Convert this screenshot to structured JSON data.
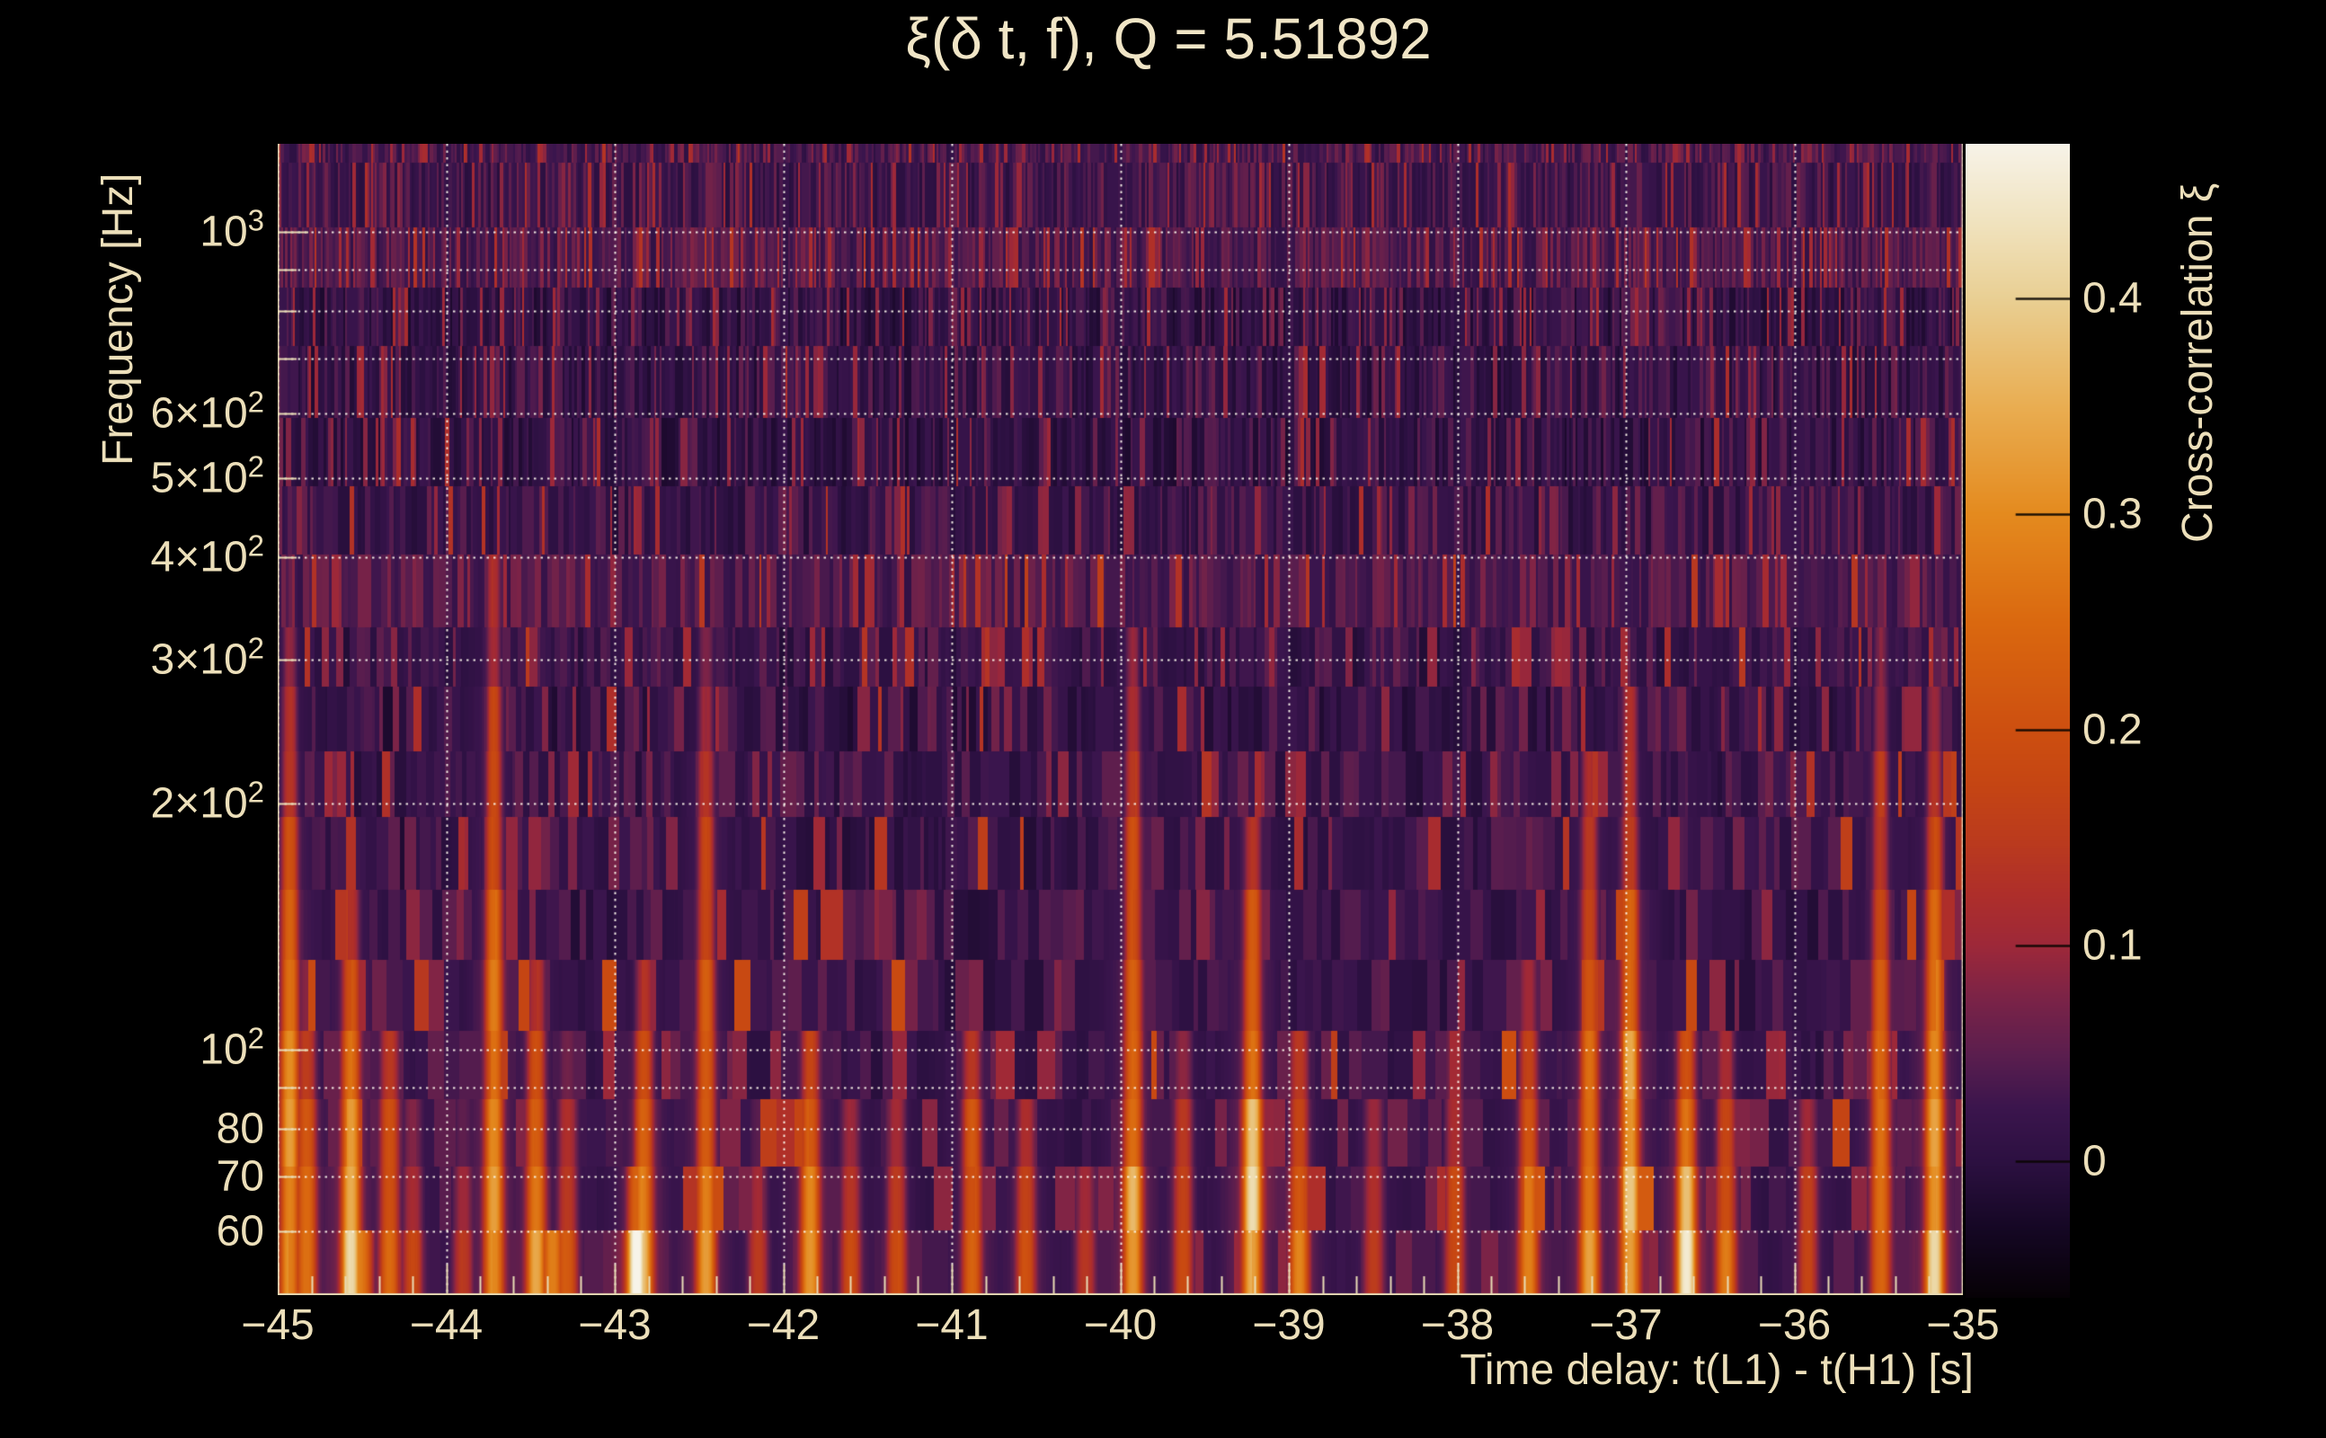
{
  "page": {
    "background": "#000000",
    "text_color": "#ecdfba",
    "title_color": "#f0e5c6"
  },
  "chart_data": {
    "type": "heatmap",
    "title": "ξ(δ t, f), Q = 5.51892",
    "q_value": 5.51892,
    "xlabel": "Time delay: t(L1) - t(H1) [s]",
    "ylabel": "Frequency [Hz]",
    "colorbar_label": "Cross-correlation ξ",
    "x_range_s": [
      -45,
      -35
    ],
    "x_major_tick_step_s": 1,
    "x_minor_tick_step_s": 0.2,
    "x_ticks": [
      {
        "t": -45,
        "label": "−45"
      },
      {
        "t": -44,
        "label": "−44"
      },
      {
        "t": -43,
        "label": "−43"
      },
      {
        "t": -42,
        "label": "−42"
      },
      {
        "t": -41,
        "label": "−41"
      },
      {
        "t": -40,
        "label": "−40"
      },
      {
        "t": -39,
        "label": "−39"
      },
      {
        "t": -38,
        "label": "−38"
      },
      {
        "t": -37,
        "label": "−37"
      },
      {
        "t": -36,
        "label": "−36"
      },
      {
        "t": -35,
        "label": "−35"
      }
    ],
    "y_scale": "log",
    "y_range_hz": [
      50,
      1282
    ],
    "y_ticks": [
      {
        "f": 1000,
        "base": "10",
        "sup": "3"
      },
      {
        "f": 600,
        "base": "6×10",
        "sup": "2"
      },
      {
        "f": 500,
        "base": "5×10",
        "sup": "2"
      },
      {
        "f": 400,
        "base": "4×10",
        "sup": "2"
      },
      {
        "f": 300,
        "base": "3×10",
        "sup": "2"
      },
      {
        "f": 200,
        "base": "2×10",
        "sup": "2"
      },
      {
        "f": 100,
        "base": "10",
        "sup": "2"
      },
      {
        "f": 80,
        "base": "80"
      },
      {
        "f": 70,
        "base": "70"
      },
      {
        "f": 60,
        "base": "60"
      }
    ],
    "y_gridline_freqs_hz": [
      60,
      70,
      80,
      90,
      100,
      200,
      300,
      400,
      500,
      600,
      700,
      800,
      900,
      1000
    ],
    "grid_style": "dotted-white",
    "colorbar": {
      "range_xi": [
        -0.0633,
        0.4717
      ],
      "ticks": [
        {
          "v": 0.4,
          "label": "0.4"
        },
        {
          "v": 0.3,
          "label": "0.3"
        },
        {
          "v": 0.2,
          "label": "0.2"
        },
        {
          "v": 0.1,
          "label": "0.1"
        },
        {
          "v": 0.0,
          "label": "0"
        }
      ]
    },
    "colormap_stops": [
      [
        0.0,
        "#060105"
      ],
      [
        0.06,
        "#150724"
      ],
      [
        0.118,
        "#2c1041"
      ],
      [
        0.165,
        "#3b154d"
      ],
      [
        0.211,
        "#5b1e4e"
      ],
      [
        0.26,
        "#7b2347"
      ],
      [
        0.305,
        "#9d2839"
      ],
      [
        0.35,
        "#ae2e2a"
      ],
      [
        0.398,
        "#bb3b1d"
      ],
      [
        0.445,
        "#c54513"
      ],
      [
        0.492,
        "#cd4f10"
      ],
      [
        0.585,
        "#da680f"
      ],
      [
        0.679,
        "#e48a1e"
      ],
      [
        0.772,
        "#e9ad51"
      ],
      [
        0.866,
        "#e9cf93"
      ],
      [
        0.93,
        "#f0e2bd"
      ],
      [
        1.0,
        "#f7f3e8"
      ]
    ],
    "noise_model": {
      "seed": 20240917,
      "background_xi_mean": 0.01,
      "background_xi_spread": 0.05,
      "description": "mostly-dark purple Q-transform noise tiles; tile width grows toward low frequency; sparse brighter red/orange tiles, densest below ~130 Hz"
    },
    "hot_streaks": [
      {
        "t_s": -44.93,
        "f_max_hz": 360,
        "peak_xi": 0.3
      },
      {
        "t_s": -44.83,
        "f_max_hz": 120,
        "peak_xi": 0.26
      },
      {
        "t_s": -44.57,
        "f_max_hz": 170,
        "peak_xi": 0.34
      },
      {
        "t_s": -44.5,
        "f_max_hz": 58,
        "peak_xi": 0.4
      },
      {
        "t_s": -44.34,
        "f_max_hz": 115,
        "peak_xi": 0.25
      },
      {
        "t_s": -44.2,
        "f_max_hz": 90,
        "peak_xi": 0.17
      },
      {
        "t_s": -43.9,
        "f_max_hz": 80,
        "peak_xi": 0.15
      },
      {
        "t_s": -43.72,
        "f_max_hz": 430,
        "peak_xi": 0.29
      },
      {
        "t_s": -43.47,
        "f_max_hz": 140,
        "peak_xi": 0.32
      },
      {
        "t_s": -43.37,
        "f_max_hz": 62,
        "peak_xi": 0.43
      },
      {
        "t_s": -43.28,
        "f_max_hz": 100,
        "peak_xi": 0.21
      },
      {
        "t_s": -42.87,
        "f_max_hz": 76,
        "peak_xi": 0.46
      },
      {
        "t_s": -42.83,
        "f_max_hz": 140,
        "peak_xi": 0.28
      },
      {
        "t_s": -42.46,
        "f_max_hz": 310,
        "peak_xi": 0.28
      },
      {
        "t_s": -42.15,
        "f_max_hz": 80,
        "peak_xi": 0.16
      },
      {
        "t_s": -41.84,
        "f_max_hz": 115,
        "peak_xi": 0.3
      },
      {
        "t_s": -41.6,
        "f_max_hz": 90,
        "peak_xi": 0.17
      },
      {
        "t_s": -41.33,
        "f_max_hz": 85,
        "peak_xi": 0.24
      },
      {
        "t_s": -40.88,
        "f_max_hz": 115,
        "peak_xi": 0.28
      },
      {
        "t_s": -40.56,
        "f_max_hz": 95,
        "peak_xi": 0.19
      },
      {
        "t_s": -40.21,
        "f_max_hz": 75,
        "peak_xi": 0.15
      },
      {
        "t_s": -39.93,
        "f_max_hz": 330,
        "peak_xi": 0.32
      },
      {
        "t_s": -39.63,
        "f_max_hz": 105,
        "peak_xi": 0.22
      },
      {
        "t_s": -39.22,
        "f_max_hz": 190,
        "peak_xi": 0.38
      },
      {
        "t_s": -38.94,
        "f_max_hz": 115,
        "peak_xi": 0.27
      },
      {
        "t_s": -38.5,
        "f_max_hz": 95,
        "peak_xi": 0.17
      },
      {
        "t_s": -38.02,
        "f_max_hz": 105,
        "peak_xi": 0.21
      },
      {
        "t_s": -37.58,
        "f_max_hz": 135,
        "peak_xi": 0.25
      },
      {
        "t_s": -37.22,
        "f_max_hz": 240,
        "peak_xi": 0.29
      },
      {
        "t_s": -36.98,
        "f_max_hz": 290,
        "peak_xi": 0.32
      },
      {
        "t_s": -36.64,
        "f_max_hz": 115,
        "peak_xi": 0.38
      },
      {
        "t_s": -36.41,
        "f_max_hz": 105,
        "peak_xi": 0.23
      },
      {
        "t_s": -35.92,
        "f_max_hz": 95,
        "peak_xi": 0.19
      },
      {
        "t_s": -35.49,
        "f_max_hz": 310,
        "peak_xi": 0.27
      },
      {
        "t_s": -35.17,
        "f_max_hz": 290,
        "peak_xi": 0.33
      }
    ],
    "frame_color": "#e8dbb5",
    "gridline_color": "rgba(252,247,235,0.92)"
  }
}
